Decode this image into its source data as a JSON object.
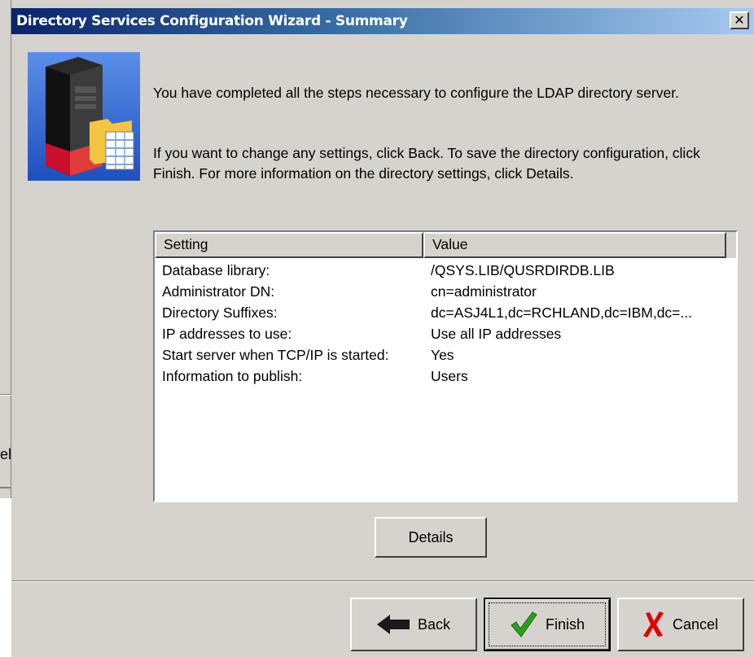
{
  "background_window": {
    "cancel_fragment": "Cancel"
  },
  "dialog": {
    "title": "Directory Services Configuration Wizard - Summary",
    "close_glyph": "✕",
    "icon": "server-with-folder-icon",
    "message1": "You have completed all the steps necessary to configure the LDAP directory server.",
    "message2": "If you want to change any settings, click Back. To save the directory configuration, click Finish. For more information on the directory settings, click Details.",
    "table": {
      "headers": [
        "Setting",
        "Value"
      ],
      "rows": [
        {
          "setting": "Database library:",
          "value": "/QSYS.LIB/QUSRDIRDB.LIB"
        },
        {
          "setting": "Administrator DN:",
          "value": "cn=administrator"
        },
        {
          "setting": "Directory Suffixes:",
          "value": "dc=ASJ4L1,dc=RCHLAND,dc=IBM,dc=..."
        },
        {
          "setting": "IP addresses to use:",
          "value": "Use all IP addresses"
        },
        {
          "setting": "Start server when TCP/IP is started:",
          "value": "Yes"
        },
        {
          "setting": "Information to publish:",
          "value": "Users"
        }
      ]
    },
    "buttons": {
      "details": "Details",
      "back": "Back",
      "finish": "Finish",
      "cancel": "Cancel"
    },
    "colors": {
      "title_gradient_start": "#0a246a",
      "title_gradient_end": "#a6caf0",
      "dialog_bg": "#d6d3ce",
      "finish_check": "#2e9e1e",
      "cancel_x": "#e00000"
    }
  }
}
